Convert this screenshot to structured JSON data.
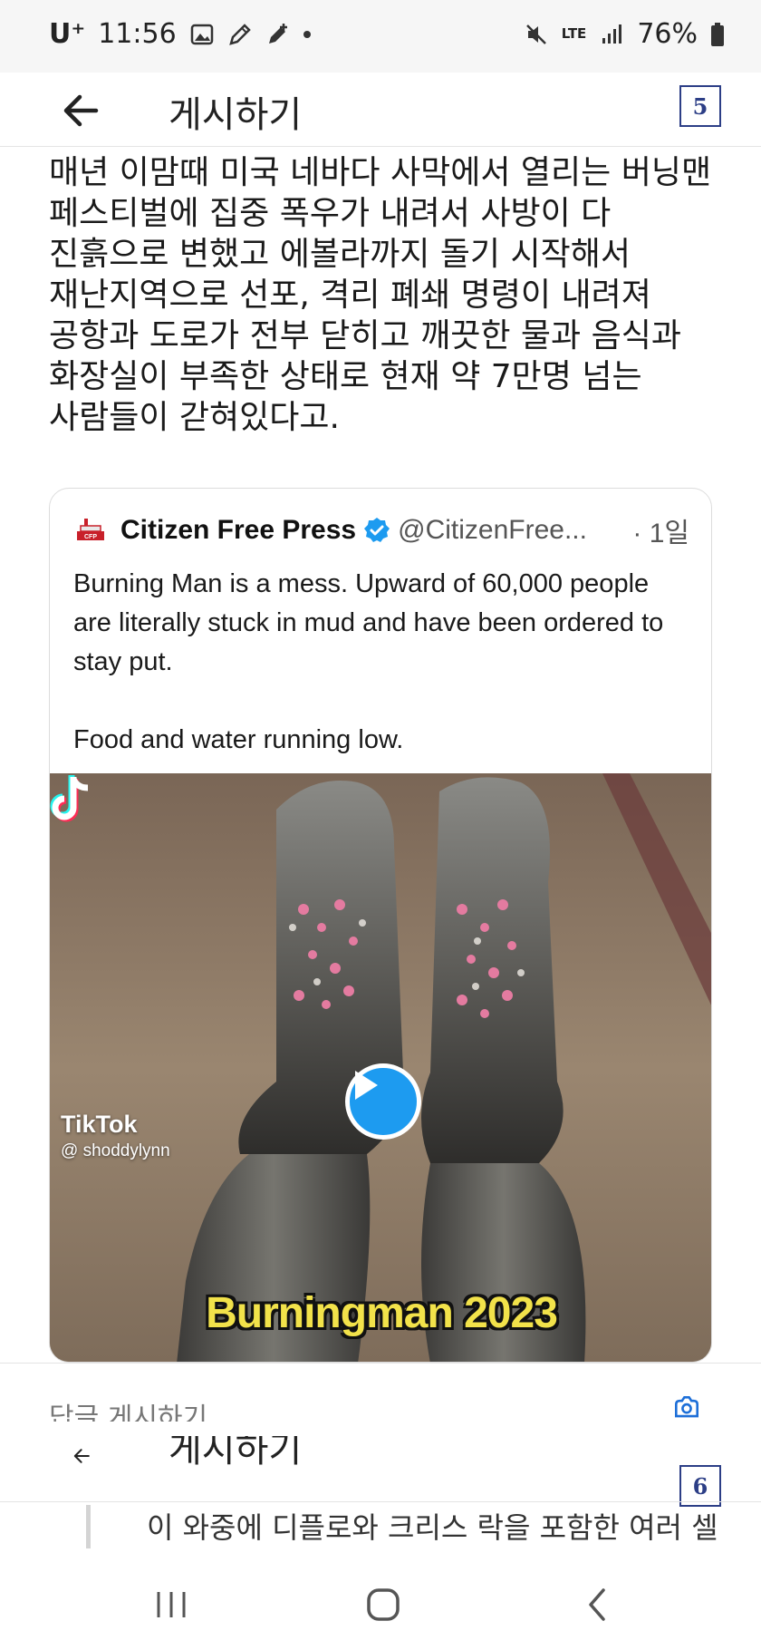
{
  "status_bar": {
    "carrier": "U⁺",
    "time": "11:56",
    "network": "LTE",
    "battery": "76%"
  },
  "header": {
    "title": "게시하기",
    "page_number": "5"
  },
  "post": {
    "body": "매년 이맘때 미국 네바다 사막에서 열리는 버닝맨 페스티벌에 집중 폭우가 내려서 사방이 다 진흙으로 변했고 에볼라까지 돌기 시작해서 재난지역으로 선포, 격리 폐쇄 명령이 내려져 공항과 도로가 전부 닫히고 깨끗한 물과 음식과 화장실이 부족한 상태로 현재 약 7만명 넘는 사람들이 갇혀있다고."
  },
  "tweet": {
    "author_name": "Citizen Free Press",
    "handle": "@CitizenFree...",
    "date": "· 1일",
    "text_1": "Burning Man is a mess. Upward of 60,000 people are literally stuck in mud and have been ordered to stay put.",
    "text_2": "Food and water running low.",
    "media": {
      "watermark_name": "TikTok",
      "watermark_user": "@ shoddylynn",
      "caption": "Burningman 2023"
    }
  },
  "second_post": {
    "cut_label": "답글 게시하기",
    "header_title": "게시하기",
    "page_number": "6",
    "body_start": "이 와중에 디플로와 크리스 락을 포함한 여러 셀"
  },
  "colors": {
    "verified_blue": "#1d9bf0",
    "badge_navy": "#2c3e86",
    "caption_yellow": "#f2e24a"
  }
}
